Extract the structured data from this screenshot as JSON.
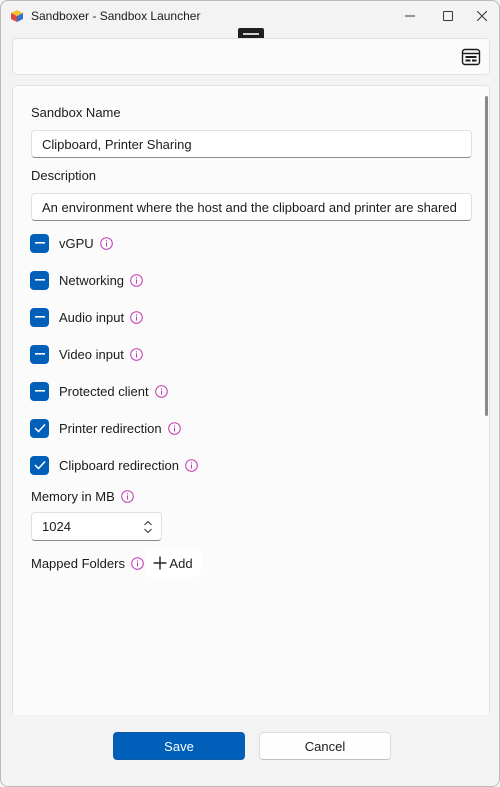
{
  "window": {
    "title": "Sandboxer - Sandbox Launcher",
    "app_icon": "cube-icon",
    "controls": [
      "minimize-icon",
      "maximize-icon",
      "close-icon"
    ]
  },
  "toolbar": {
    "icon": "window-layout-icon"
  },
  "form": {
    "name_label": "Sandbox Name",
    "name_value": "Clipboard, Printer Sharing",
    "description_label": "Description",
    "description_value": "An environment where the host and the clipboard and printer are shared",
    "options": [
      {
        "label": "vGPU",
        "state": "indeterminate"
      },
      {
        "label": "Networking",
        "state": "indeterminate"
      },
      {
        "label": "Audio input",
        "state": "indeterminate"
      },
      {
        "label": "Video input",
        "state": "indeterminate"
      },
      {
        "label": "Protected client",
        "state": "indeterminate"
      },
      {
        "label": "Printer redirection",
        "state": "checked"
      },
      {
        "label": "Clipboard redirection",
        "state": "checked"
      }
    ],
    "memory_label": "Memory in MB",
    "memory_value": "1024",
    "mapped_folders_label": "Mapped Folders",
    "add_label": "Add"
  },
  "footer": {
    "save_label": "Save",
    "cancel_label": "Cancel"
  },
  "colors": {
    "accent": "#005fb8",
    "info": "#c239b3"
  }
}
